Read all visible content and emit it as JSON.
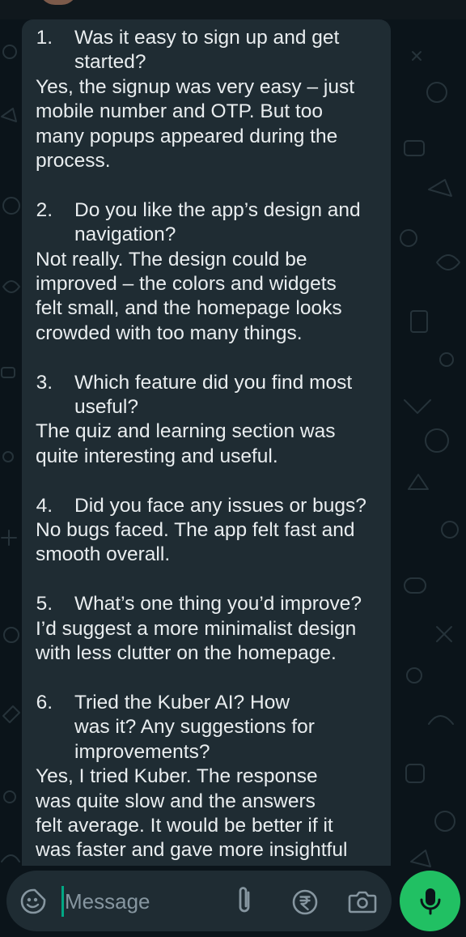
{
  "chat": {
    "message_items": [
      {
        "number": "1.",
        "question_lines": [
          "Was it easy to sign up and get",
          "started?"
        ],
        "answer_lines": [
          "Yes, the signup was very easy – just",
          "mobile number and OTP. But too",
          "many popups appeared during the",
          "process."
        ]
      },
      {
        "number": "2.",
        "question_lines": [
          "Do you like the app’s design and",
          "navigation?"
        ],
        "answer_lines": [
          "Not really. The design could be",
          "improved – the colors and widgets",
          "felt small, and the homepage looks",
          "crowded with too many things."
        ]
      },
      {
        "number": "3.",
        "question_lines": [
          "Which feature did you find most",
          "useful?"
        ],
        "answer_lines": [
          "The quiz and learning section was",
          "quite interesting and useful."
        ]
      },
      {
        "number": "4.",
        "question_lines": [
          "Did you face any issues or bugs?"
        ],
        "answer_lines": [
          "No bugs faced. The app felt fast and",
          "smooth overall."
        ]
      },
      {
        "number": "5.",
        "question_lines": [
          "What’s one thing you’d improve?"
        ],
        "answer_lines": [
          "I’d suggest a more minimalist design",
          "with less clutter on the homepage."
        ]
      },
      {
        "number": "6.",
        "question_lines": [
          "Tried the Kuber AI? How",
          "was it? Any suggestions for",
          "improvements?"
        ],
        "answer_lines": [
          "Yes, I tried Kuber. The response",
          "was quite slow and the answers",
          "felt average. It would be better if it",
          "was faster and gave more insightful"
        ]
      }
    ]
  },
  "composer": {
    "placeholder": "Message",
    "icons": {
      "emoji": "emoji-sticker-icon",
      "attach": "paperclip-icon",
      "payment": "rupee-payment-icon",
      "camera": "camera-icon",
      "mic": "microphone-icon"
    }
  },
  "colors": {
    "background": "#0b141a",
    "bubble": "#1f2c33",
    "text": "#e9edef",
    "placeholder": "#8696a0",
    "accent": "#21c063",
    "caret": "#00a884"
  }
}
